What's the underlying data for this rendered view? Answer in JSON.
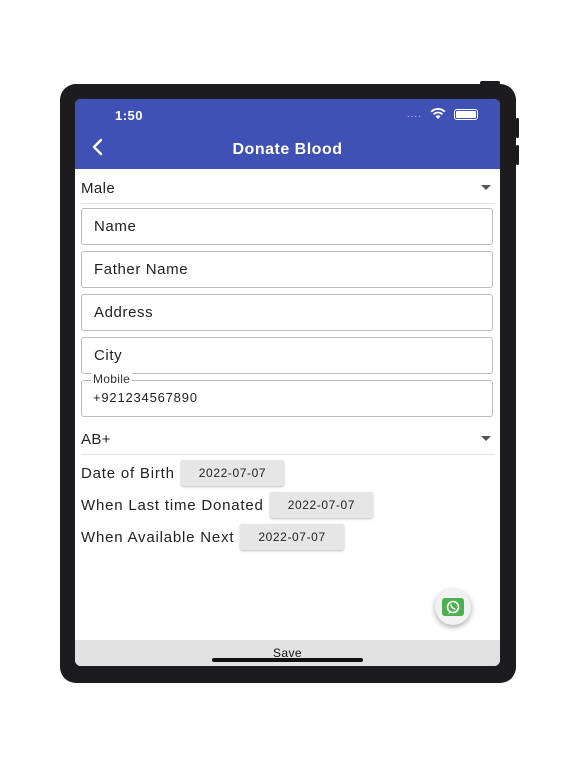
{
  "status_bar": {
    "time": "1:50",
    "signal_dots": "....",
    "wifi_icon": "wifi-icon",
    "battery_icon": "battery-icon"
  },
  "header": {
    "title": "Donate Blood",
    "back_icon": "chevron-left-icon",
    "color": "#3f51b5"
  },
  "form": {
    "gender": "Male",
    "name_placeholder": "Name",
    "father_name_placeholder": "Father Name",
    "address_placeholder": "Address",
    "city_placeholder": "City",
    "mobile_label": "Mobile",
    "mobile_value": "+921234567890",
    "blood_group": "AB+",
    "dob_label": "Date of Birth",
    "dob_value": "2022-07-07",
    "last_donated_label": "When Last time Donated",
    "last_donated_value": "2022-07-07",
    "available_next_label": "When Available Next",
    "available_next_value": "2022-07-07"
  },
  "fab": {
    "icon": "whatsapp-icon",
    "color": "#4caf50"
  },
  "footer": {
    "save_label": "Save"
  }
}
